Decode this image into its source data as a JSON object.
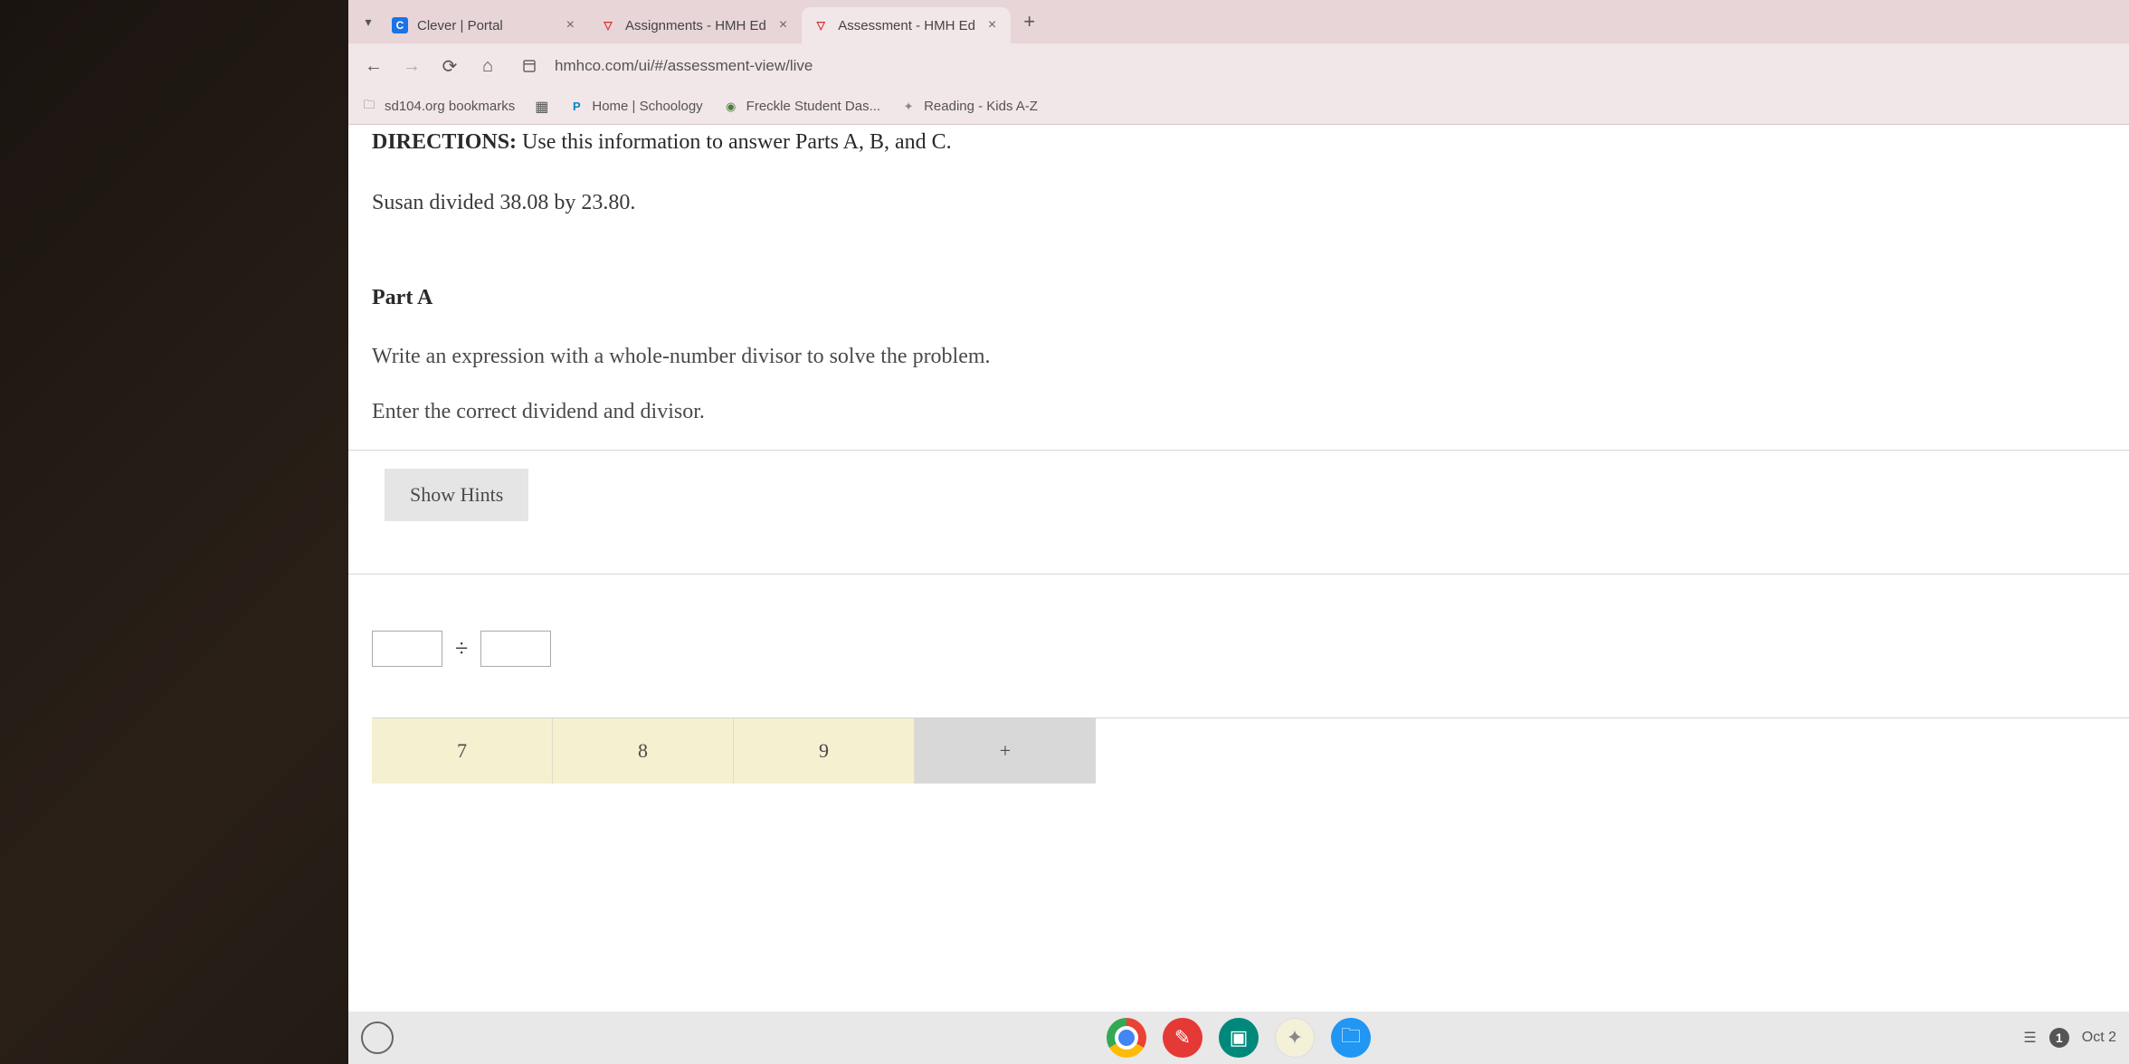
{
  "browser": {
    "tabs": [
      {
        "title": "Clever | Portal",
        "favicon": "C",
        "active": false
      },
      {
        "title": "Assignments - HMH Ed",
        "favicon": "▽",
        "active": false
      },
      {
        "title": "Assessment - HMH Ed",
        "favicon": "▽",
        "active": true
      }
    ],
    "url": "hmhco.com/ui/#/assessment-view/live"
  },
  "bookmarks": {
    "folder": "sd104.org bookmarks",
    "items": [
      {
        "label": "Home | Schoology"
      },
      {
        "label": "Freckle Student Das..."
      },
      {
        "label": "Reading - Kids A-Z"
      }
    ]
  },
  "assessment": {
    "directions_prefix": "DIRECTIONS:",
    "directions_text": " Use this information to answer Parts A, B, and C.",
    "problem": "Susan divided 38.08 by 23.80.",
    "part_label": "Part A",
    "instruction1": "Write an expression with a whole-number divisor to solve the problem.",
    "instruction2": "Enter the correct dividend and divisor.",
    "hints_button": "Show Hints",
    "divide_symbol": "÷",
    "dividend_value": "",
    "divisor_value": "",
    "keypad": {
      "keys": [
        "7",
        "8",
        "9",
        "+"
      ]
    }
  },
  "shelf": {
    "notification_count": "1",
    "date": "Oct 2"
  }
}
